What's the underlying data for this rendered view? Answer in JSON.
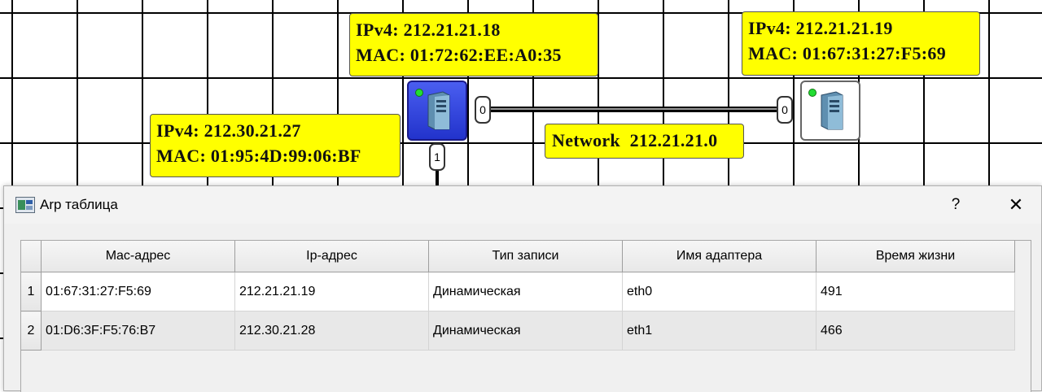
{
  "canvas": {
    "hosts": [
      {
        "ipv4": "IPv4: 212.21.21.18",
        "mac": "MAC: 01:72:62:EE:A0:35"
      },
      {
        "ipv4": "IPv4: 212.21.21.19",
        "mac": "MAC: 01:67:31:27:F5:69"
      },
      {
        "ipv4": "IPv4: 212.30.21.27",
        "mac": "MAC: 01:95:4D:99:06:BF"
      }
    ],
    "network_label": "Network  212.21.21.0",
    "ports": {
      "router_port_0": "0",
      "router_port_1": "1",
      "host_port_0": "0"
    },
    "colors": {
      "label_bg": "#ffff00",
      "selected_device": "#3344dd",
      "led": "#22dd33"
    }
  },
  "dialog": {
    "title": "Arp таблица",
    "help_label": "?",
    "close_label": "✕",
    "columns": [
      "Mac-адрес",
      "Ip-адрес",
      "Тип записи",
      "Имя адаптера",
      "Время жизни"
    ],
    "rows": [
      {
        "num": "1",
        "mac": "01:67:31:27:F5:69",
        "ip": "212.21.21.19",
        "type": "Динамическая",
        "adapter": "eth0",
        "ttl": "491"
      },
      {
        "num": "2",
        "mac": "01:D6:3F:F5:76:B7",
        "ip": "212.30.21.28",
        "type": "Динамическая",
        "adapter": "eth1",
        "ttl": "466"
      }
    ]
  }
}
